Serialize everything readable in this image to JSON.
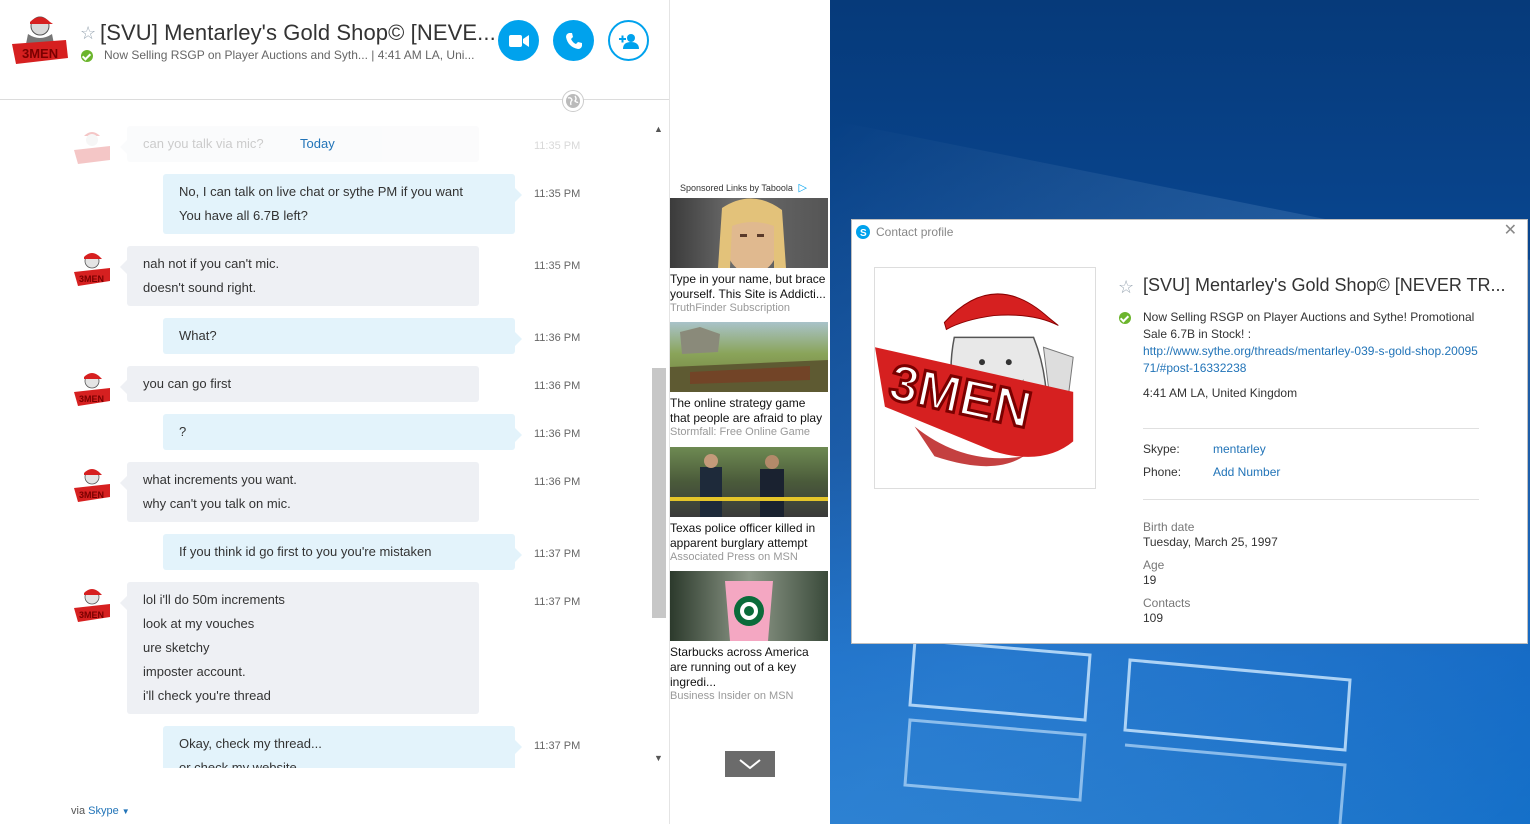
{
  "chat": {
    "title": "[SVU] Mentarley's Gold Shop© [NEVE...",
    "mood": "Now Selling RSGP on Player Auctions and Syth...  |  4:41 AM LA, Uni...",
    "today_label": "Today",
    "faded_message": "can you talk via mic?",
    "faded_time": "11:35 PM",
    "messages": [
      {
        "dir": "out",
        "lines": [
          "No, I can talk on live chat or sythe PM if you want",
          "You have all 6.7B left?"
        ],
        "time": "11:35 PM"
      },
      {
        "dir": "in",
        "lines": [
          "nah not if you can't mic.",
          "doesn't sound right."
        ],
        "time": "11:35 PM"
      },
      {
        "dir": "out",
        "lines": [
          "What?"
        ],
        "time": "11:36 PM"
      },
      {
        "dir": "in",
        "lines": [
          "you can go first"
        ],
        "time": "11:36 PM"
      },
      {
        "dir": "out",
        "lines": [
          "?"
        ],
        "time": "11:36 PM"
      },
      {
        "dir": "in",
        "lines": [
          "what increments you want.",
          "why can't you talk on mic."
        ],
        "time": "11:36 PM"
      },
      {
        "dir": "out",
        "lines": [
          "If you think id go first to you you're mistaken"
        ],
        "time": "11:37 PM"
      },
      {
        "dir": "in",
        "lines": [
          "lol i'll do 50m increments",
          "look at my vouches",
          "ure sketchy",
          "imposter account.",
          "i'll check you're thread"
        ],
        "time": "11:37 PM"
      },
      {
        "dir": "out",
        "lines": [
          "Okay, check my thread...",
          "or check my website"
        ],
        "time": "11:37 PM"
      }
    ],
    "via_prefix": "via",
    "via_link": "Skype"
  },
  "ads": {
    "sponsor": "Sponsored Links by Taboola",
    "items": [
      {
        "title": "Type in your name, but brace yourself. This Site is Addicti...",
        "source": "TruthFinder Subscription"
      },
      {
        "title": "The online strategy game that people are afraid to play",
        "source": "Stormfall: Free Online Game"
      },
      {
        "title": "Texas police officer killed in apparent burglary attempt",
        "source": "Associated Press on MSN"
      },
      {
        "title": "Starbucks across America are running out of a key ingredi...",
        "source": "Business Insider on MSN"
      }
    ]
  },
  "profile": {
    "window_title": "Contact profile",
    "name": "[SVU] Mentarley's Gold Shop© [NEVER TR...",
    "mood": "Now Selling RSGP on Player Auctions and Sythe! Promotional Sale 6.7B in Stock! :",
    "link": "http://www.sythe.org/threads/mentarley-039-s-gold-shop.2009571/#post-16332238",
    "local_time": "4:41 AM LA, United Kingdom",
    "skype_label": "Skype:",
    "skype_value": "mentarley",
    "phone_label": "Phone:",
    "phone_value": "Add Number",
    "birth_label": "Birth date",
    "birth_value": "Tuesday, March 25, 1997",
    "age_label": "Age",
    "age_value": "19",
    "contacts_label": "Contacts",
    "contacts_value": "109"
  },
  "colors": {
    "accent": "#00a2ed",
    "link": "#2274b8",
    "online": "#6cb52d",
    "desktop": "#0b4fa0"
  }
}
